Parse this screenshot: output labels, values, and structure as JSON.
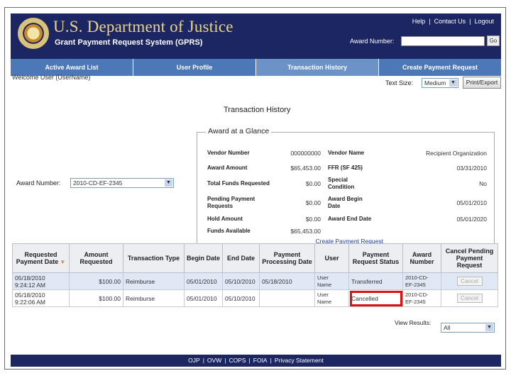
{
  "header": {
    "title": "U.S. Department of Justice",
    "subtitle": "Grant Payment Request System (GPRS)",
    "links": [
      "Help",
      "Contact Us",
      "Logout"
    ],
    "award_number_label": "Award Number:",
    "award_number_value": "",
    "go_label": "Go",
    "seal_icon": "doj-seal-icon"
  },
  "nav": {
    "tabs": [
      "Active Award List",
      "User Profile",
      "Transaction History",
      "Create Payment Request"
    ],
    "active_index": 2
  },
  "welcome": "Welcome User (UserName)",
  "text_size": {
    "label": "Text Size:",
    "value": "Medium"
  },
  "print_label": "Print/Export",
  "page_title": "Transaction History",
  "glance": {
    "title": "Award at a Glance",
    "rows": [
      {
        "l1": "Vendor Number",
        "v1": "000000000",
        "l2": "Vendor Name",
        "v2": "Recipient Organization"
      },
      {
        "l1": "Award Amount",
        "v1": "$65,453.00",
        "l2": "FFR (SF 425)",
        "v2": "03/31/2010"
      },
      {
        "l1": "Total Funds Requested",
        "v1": "$0.00",
        "l2": "Special Condition",
        "v2": "No"
      },
      {
        "l1": "Pending Payment Requests",
        "v1": "$0.00",
        "l2": "Award Begin Date",
        "v2": "05/01/2010"
      },
      {
        "l1": "Hold Amount",
        "v1": "$0.00",
        "l2": "Award End Date",
        "v2": "05/01/2020"
      },
      {
        "l1": "Funds Available",
        "v1": "$65,453.00",
        "l2": "",
        "v2": ""
      }
    ],
    "create_link": "Create Payment Request"
  },
  "award_select": {
    "label": "Award Number:",
    "value": "2010-CD-EF-2345"
  },
  "table": {
    "headers": [
      "Requested Payment Date",
      "Amount Requested",
      "Transaction Type",
      "Begin Date",
      "End Date",
      "Payment Processing Date",
      "User",
      "Payment Request Status",
      "Award Number",
      "Cancel Pending Payment Request"
    ],
    "rows": [
      {
        "date": "05/18/2010",
        "time": "9:24:12 AM",
        "amount": "$100.00",
        "type": "Reimburse",
        "begin": "05/01/2010",
        "end": "05/10/2010",
        "processing": "05/18/2010",
        "user1": "User",
        "user2": "Name",
        "status": "Transferred",
        "award1": "2010-CD-",
        "award2": "EF-2345",
        "cancel": "Cancel"
      },
      {
        "date": "05/18/2010",
        "time": "9:22:06 AM",
        "amount": "$100.00",
        "type": "Reimburse",
        "begin": "05/01/2010",
        "end": "05/10/2010",
        "processing": "",
        "user1": "User",
        "user2": "Name",
        "status": "Cancelled",
        "award1": "2010-CD-",
        "award2": "EF-2345",
        "cancel": "Cancel"
      }
    ]
  },
  "view_results": {
    "label": "View Results:",
    "value": "All"
  },
  "footer": {
    "links": [
      "OJP",
      "OVW",
      "COPS",
      "FOIA",
      "Privacy Statement"
    ]
  },
  "colors": {
    "header_bg": "#1b2663",
    "nav_bg": "#4c78b7",
    "title_gold": "#e9d48a",
    "highlight": "#e01010"
  }
}
